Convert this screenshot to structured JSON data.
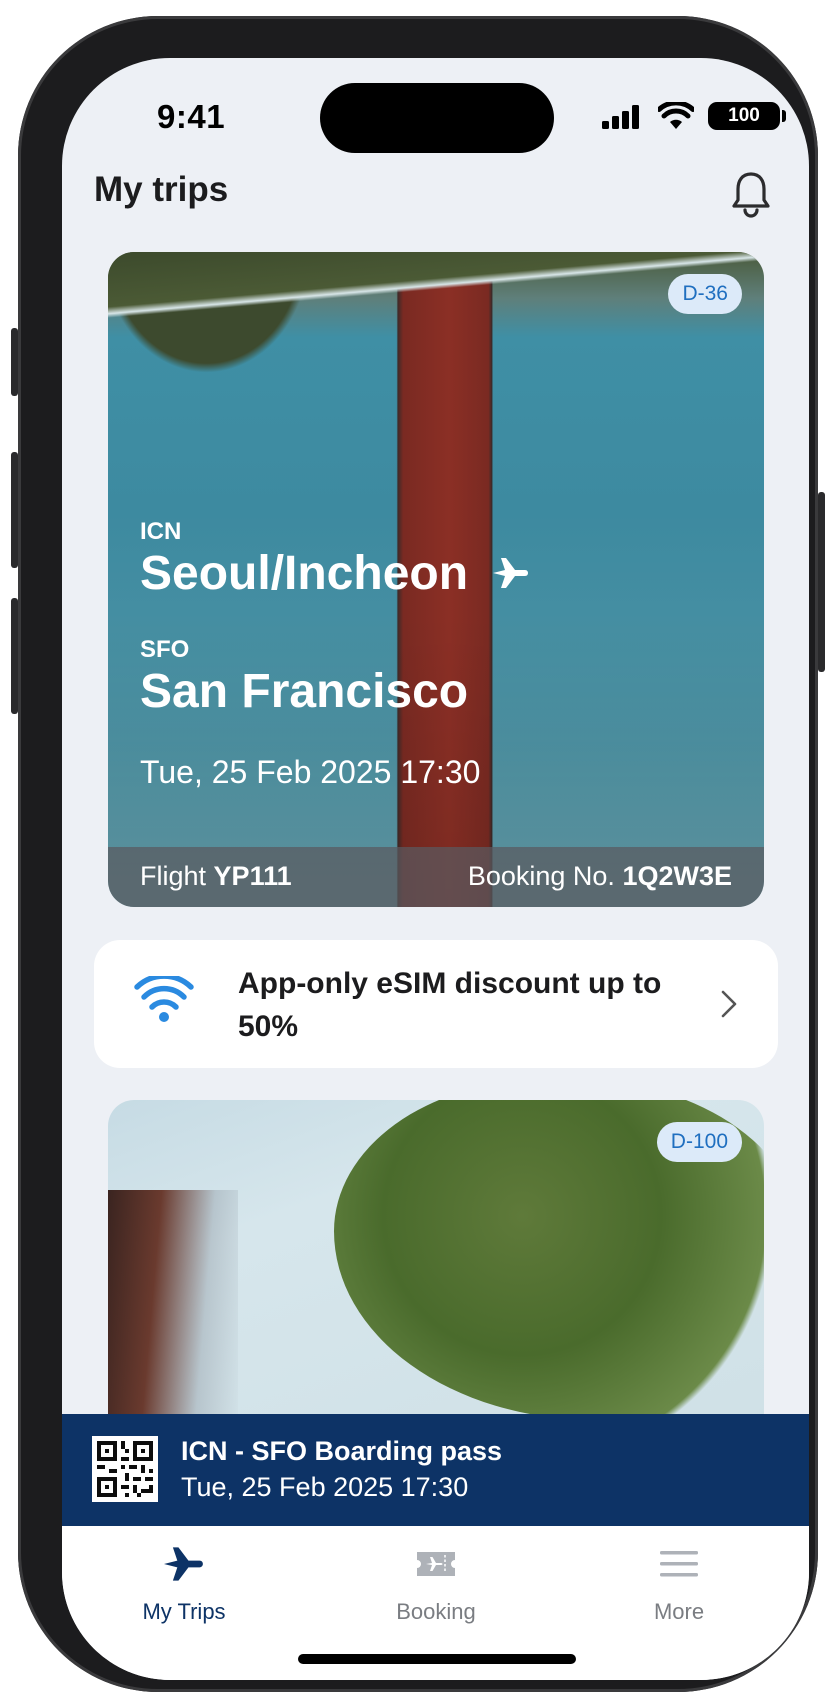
{
  "status_bar": {
    "time": "9:41",
    "battery": "100"
  },
  "header": {
    "title": "My trips"
  },
  "trip_cards": [
    {
      "dday": "D-36",
      "origin_code": "ICN",
      "origin_city": "Seoul/Incheon",
      "destination_code": "SFO",
      "destination_city": "San Francisco",
      "datetime": "Tue, 25 Feb 2025 17:30",
      "flight_label": "Flight",
      "flight_number": "YP111",
      "booking_label": "Booking No.",
      "booking_number": "1Q2W3E"
    },
    {
      "dday": "D-100"
    }
  ],
  "promo": {
    "text": "App-only eSIM discount up to 50%"
  },
  "boarding_pass": {
    "title": "ICN - SFO Boarding pass",
    "datetime": "Tue, 25 Feb 2025 17:30"
  },
  "tabs": [
    {
      "label": "My Trips",
      "icon": "airplane-icon",
      "active": true
    },
    {
      "label": "Booking",
      "icon": "ticket-icon",
      "active": false
    },
    {
      "label": "More",
      "icon": "menu-icon",
      "active": false
    }
  ],
  "colors": {
    "navy": "#0d3366",
    "accent_blue": "#1f6fc0",
    "wifi_blue": "#2a8ae0",
    "background": "#edf0f5"
  }
}
